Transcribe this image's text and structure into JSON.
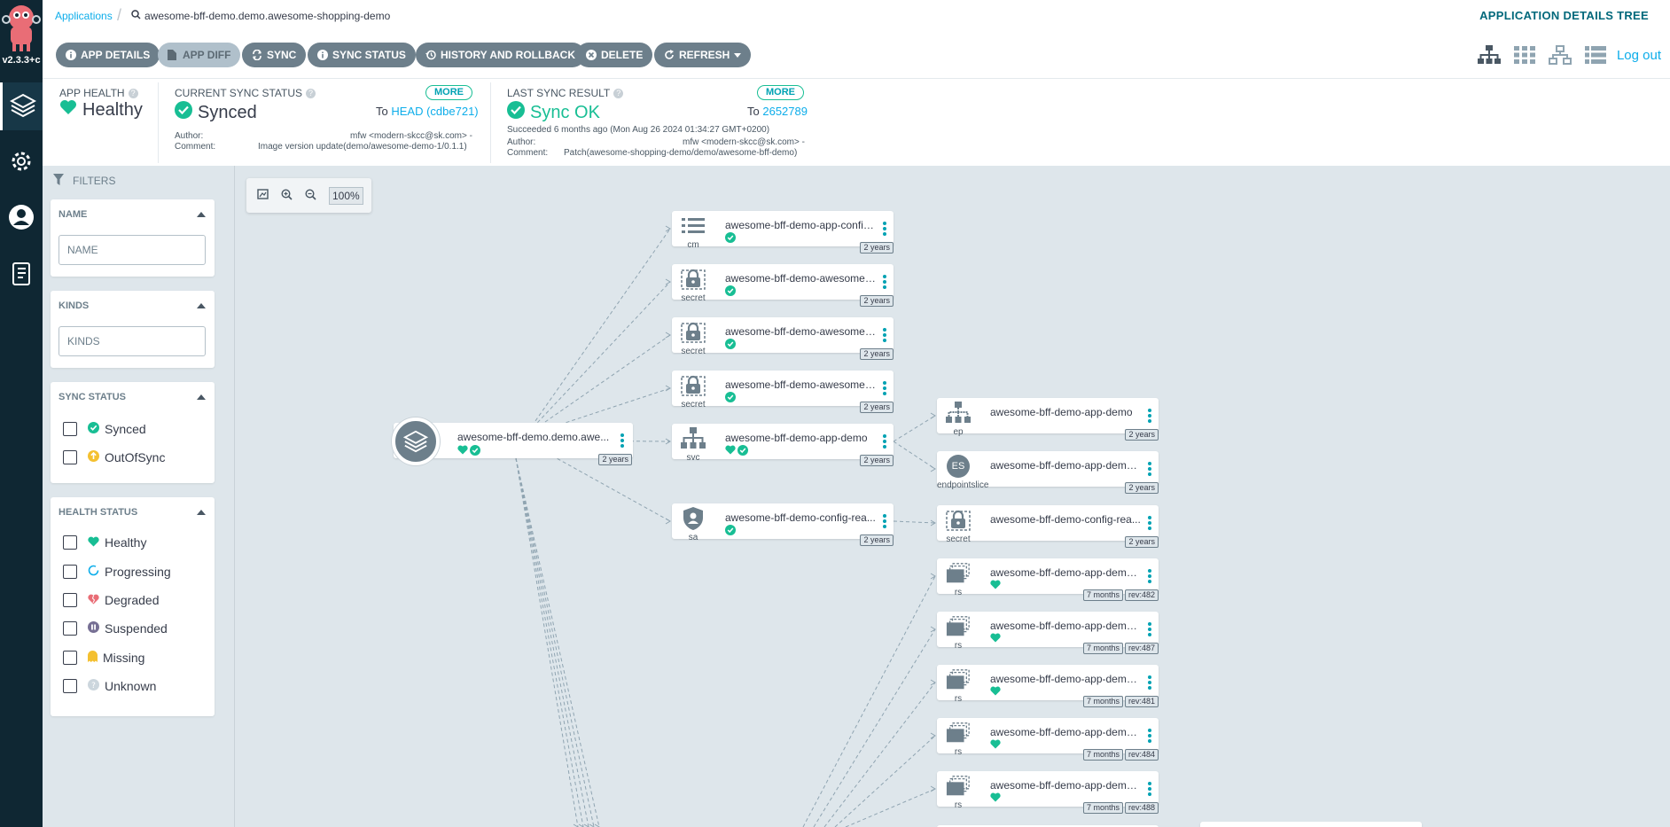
{
  "nav": {
    "version": "v2.3.3+c",
    "items": [
      "applications-icon",
      "settings-icon",
      "user-info-icon",
      "documentation-icon"
    ]
  },
  "topbar": {
    "breadcrumb_root": "Applications",
    "breadcrumb_current": "awesome-bff-demo.demo.awesome-shopping-demo",
    "page_title": "APPLICATION DETAILS TREE"
  },
  "toolbar": {
    "buttons": [
      {
        "label": "APP DETAILS",
        "icon": "info-icon",
        "disabled": false
      },
      {
        "label": "APP DIFF",
        "icon": "file-icon",
        "disabled": true
      },
      {
        "label": "SYNC",
        "icon": "sync-icon",
        "disabled": false
      },
      {
        "label": "SYNC STATUS",
        "icon": "info-icon",
        "disabled": false
      },
      {
        "label": "HISTORY AND ROLLBACK",
        "icon": "history-icon",
        "disabled": false
      },
      {
        "label": "DELETE",
        "icon": "close-circle-icon",
        "disabled": false
      },
      {
        "label": "REFRESH",
        "icon": "redo-icon",
        "disabled": false
      }
    ],
    "view_icons": [
      "tree-view-icon",
      "pods-view-icon",
      "network-view-icon",
      "list-view-icon"
    ],
    "logout": "Log out"
  },
  "status": {
    "health": {
      "label": "APP HEALTH",
      "value": "Healthy"
    },
    "sync": {
      "label": "CURRENT SYNC STATUS",
      "value": "Synced",
      "more": "MORE",
      "to_prefix": "To",
      "to_value": "HEAD (cdbe721)",
      "author_label": "Author:",
      "author": "mfw <modern-skcc@sk.com> -",
      "comment_label": "Comment:",
      "comment": "Image version update(demo/awesome-demo-1/0.1.1)"
    },
    "last_sync": {
      "label": "LAST SYNC RESULT",
      "value": "Sync OK",
      "more": "MORE",
      "to_prefix": "To",
      "to_value": "2652789",
      "succeeded": "Succeeded 6 months ago (Mon Aug 26 2024 01:34:27 GMT+0200)",
      "author_label": "Author:",
      "author": "mfw <modern-skcc@sk.com> -",
      "comment_label": "Comment:",
      "comment": "Patch(awesome-shopping-demo/demo/awesome-bff-demo)"
    }
  },
  "filters": {
    "title": "FILTERS",
    "name": {
      "title": "NAME",
      "placeholder": "NAME"
    },
    "kinds": {
      "title": "KINDS",
      "placeholder": "KINDS"
    },
    "sync_status": {
      "title": "SYNC STATUS",
      "options": [
        "Synced",
        "OutOfSync"
      ]
    },
    "health_status": {
      "title": "HEALTH STATUS",
      "options": [
        "Healthy",
        "Progressing",
        "Degraded",
        "Suspended",
        "Missing",
        "Unknown"
      ]
    }
  },
  "graph": {
    "zoom": "100%",
    "app_node": {
      "name": "awesome-bff-demo.demo.awe...",
      "age": "2 years"
    },
    "col1": [
      {
        "kind": "cm",
        "name": "awesome-bff-demo-app-config...",
        "age": "2 years",
        "status": [
          "synced"
        ]
      },
      {
        "kind": "secret",
        "name": "awesome-bff-demo-awesome-...",
        "age": "2 years",
        "status": [
          "synced"
        ]
      },
      {
        "kind": "secret",
        "name": "awesome-bff-demo-awesome-...",
        "age": "2 years",
        "status": [
          "synced"
        ]
      },
      {
        "kind": "secret",
        "name": "awesome-bff-demo-awesome-...",
        "age": "2 years",
        "status": [
          "synced"
        ]
      },
      {
        "kind": "svc",
        "name": "awesome-bff-demo-app-demo",
        "age": "2 years",
        "status": [
          "healthy",
          "synced"
        ]
      },
      {
        "kind": "sa",
        "name": "awesome-bff-demo-config-rea...",
        "age": "2 years",
        "status": [
          "synced"
        ]
      }
    ],
    "col2": [
      {
        "kind": "ep",
        "name": "awesome-bff-demo-app-demo",
        "age": "2 years",
        "status": [],
        "rev": ""
      },
      {
        "kind": "endpointslice",
        "name": "awesome-bff-demo-app-demo-...",
        "age": "2 years",
        "status": [],
        "rev": "",
        "badge": "ES"
      },
      {
        "kind": "secret",
        "name": "awesome-bff-demo-config-rea...",
        "age": "2 years",
        "status": [],
        "rev": ""
      },
      {
        "kind": "rs",
        "name": "awesome-bff-demo-app-demo-...",
        "age": "7 months",
        "status": [
          "healthy"
        ],
        "rev": "rev:482"
      },
      {
        "kind": "rs",
        "name": "awesome-bff-demo-app-demo-...",
        "age": "7 months",
        "status": [
          "healthy"
        ],
        "rev": "rev:487"
      },
      {
        "kind": "rs",
        "name": "awesome-bff-demo-app-demo-...",
        "age": "7 months",
        "status": [
          "healthy"
        ],
        "rev": "rev:481"
      },
      {
        "kind": "rs",
        "name": "awesome-bff-demo-app-demo-...",
        "age": "7 months",
        "status": [
          "healthy"
        ],
        "rev": "rev:484"
      },
      {
        "kind": "rs",
        "name": "awesome-bff-demo-app-demo-...",
        "age": "7 months",
        "status": [
          "healthy"
        ],
        "rev": "rev:488"
      }
    ]
  },
  "colors": {
    "healthy": "#18be94",
    "synced": "#18be94",
    "outofsync": "#f4c030",
    "degraded": "#e96d76",
    "progressing": "#0dadea",
    "suspended": "#766f94",
    "missing": "#f4c030",
    "unknown": "#ccd6dd",
    "button": "#6d7f8b"
  }
}
